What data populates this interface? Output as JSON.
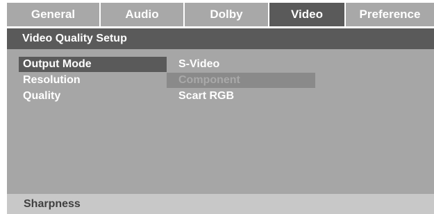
{
  "tabs": [
    {
      "label": "General"
    },
    {
      "label": "Audio"
    },
    {
      "label": "Dolby"
    },
    {
      "label": "Video"
    },
    {
      "label": "Preference"
    }
  ],
  "header": {
    "title": "Video Quality Setup"
  },
  "menu": {
    "items": [
      {
        "label": "Output Mode"
      },
      {
        "label": "Resolution"
      },
      {
        "label": "Quality"
      }
    ],
    "options": [
      {
        "label": "S-Video"
      },
      {
        "label": "Component"
      },
      {
        "label": "Scart RGB"
      }
    ]
  },
  "footer": {
    "hint": "Sharpness"
  },
  "colors": {
    "panel": "#a6a6a6",
    "active": "#5a5a5a",
    "highlight": "#8a8a8a",
    "footer": "#c8c8c8"
  }
}
